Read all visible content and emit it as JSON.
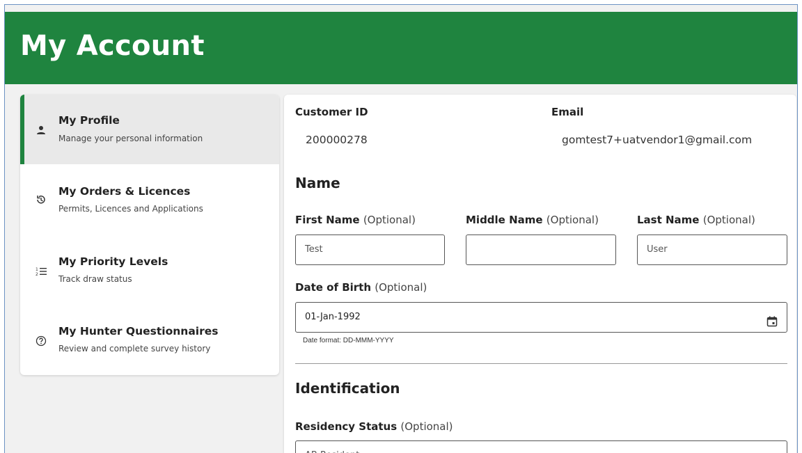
{
  "header": {
    "title": "My Account"
  },
  "sidebar": {
    "items": [
      {
        "title": "My Profile",
        "subtitle": "Manage your personal information",
        "icon": "person-icon"
      },
      {
        "title": "My Orders & Licences",
        "subtitle": "Permits, Licences and Applications",
        "icon": "history-icon"
      },
      {
        "title": "My Priority Levels",
        "subtitle": "Track draw status",
        "icon": "numbered-list-icon"
      },
      {
        "title": "My Hunter Questionnaires",
        "subtitle": "Review and complete survey history",
        "icon": "help-circle-icon"
      }
    ]
  },
  "profile": {
    "customer_id_label": "Customer ID",
    "customer_id": "200000278",
    "email_label": "Email",
    "email": "gomtest7+uatvendor1@gmail.com",
    "name_heading": "Name",
    "optional_text": "(Optional)",
    "first_name_label": "First Name",
    "first_name_value": "Test",
    "middle_name_label": "Middle Name",
    "middle_name_value": "",
    "last_name_label": "Last Name",
    "last_name_value": "User",
    "dob_label": "Date of Birth",
    "dob_value": "01-Jan-1992",
    "dob_hint": "Date format: DD-MMM-YYYY",
    "identification_heading": "Identification",
    "residency_label": "Residency Status",
    "residency_value": "AB Resident"
  },
  "colors": {
    "brand_green": "#1f843f",
    "frame_border": "#6d93c4"
  }
}
